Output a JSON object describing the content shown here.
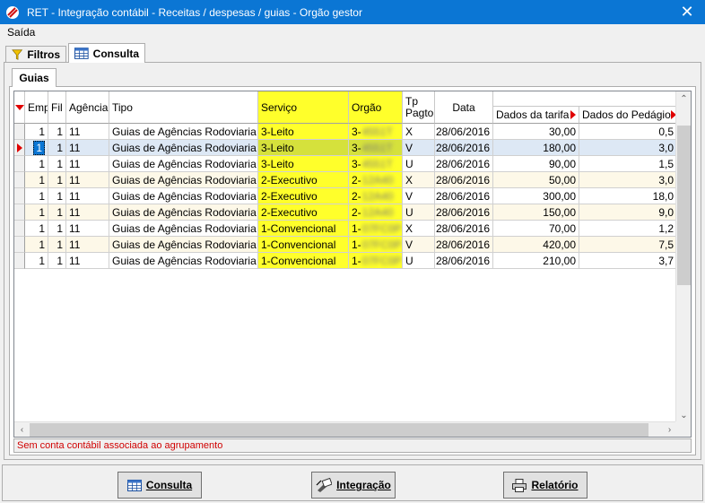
{
  "window": {
    "title": "RET -  Integração contábil - Receitas / despesas / guias - Orgão gestor",
    "close_glyph": "✕"
  },
  "menu": {
    "items": [
      "Saída"
    ]
  },
  "outer_tabs": [
    {
      "label": "Filtros",
      "icon": "funnel-icon"
    },
    {
      "label": "Consulta",
      "icon": "table-icon"
    }
  ],
  "inner_tab": {
    "label": "Guias"
  },
  "grid": {
    "columns": {
      "emp": "Emp",
      "fil": "Fil",
      "agencia": "Agência",
      "tipo": "Tipo",
      "servico": "Serviço",
      "orgao": "Orgão",
      "tp_pagto_line1": "Tp",
      "tp_pagto_line2": "Pagto",
      "data": "Data",
      "dados_tarifa": "Dados da tarifa",
      "dados_pedagio": "Dados do Pedágio"
    },
    "rows": [
      {
        "emp": "1",
        "fil": "1",
        "agencia": "11",
        "tipo": "Guias de Agências Rodoviaria I...",
        "servico": "3-Leito",
        "orgao_prefix": "3-",
        "orgao_hidden": "4551T",
        "tp": "X",
        "data": "28/06/2016",
        "tarifa": "30,00",
        "pedagio": "0,5"
      },
      {
        "emp": "1",
        "fil": "1",
        "agencia": "11",
        "tipo": "Guias de Agências Rodoviaria I...",
        "servico": "3-Leito",
        "orgao_prefix": "3-",
        "orgao_hidden": "4551T",
        "tp": "V",
        "data": "28/06/2016",
        "tarifa": "180,00",
        "pedagio": "3,0"
      },
      {
        "emp": "1",
        "fil": "1",
        "agencia": "11",
        "tipo": "Guias de Agências Rodoviaria I...",
        "servico": "3-Leito",
        "orgao_prefix": "3-",
        "orgao_hidden": "4551T",
        "tp": "U",
        "data": "28/06/2016",
        "tarifa": "90,00",
        "pedagio": "1,5"
      },
      {
        "emp": "1",
        "fil": "1",
        "agencia": "11",
        "tipo": "Guias de Agências Rodoviaria I...",
        "servico": "2-Executivo",
        "orgao_prefix": "2-",
        "orgao_hidden": "12A40",
        "tp": "X",
        "data": "28/06/2016",
        "tarifa": "50,00",
        "pedagio": "3,0"
      },
      {
        "emp": "1",
        "fil": "1",
        "agencia": "11",
        "tipo": "Guias de Agências Rodoviaria I...",
        "servico": "2-Executivo",
        "orgao_prefix": "2-",
        "orgao_hidden": "12A40",
        "tp": "V",
        "data": "28/06/2016",
        "tarifa": "300,00",
        "pedagio": "18,0"
      },
      {
        "emp": "1",
        "fil": "1",
        "agencia": "11",
        "tipo": "Guias de Agências Rodoviaria I...",
        "servico": "2-Executivo",
        "orgao_prefix": "2-",
        "orgao_hidden": "12A40",
        "tp": "U",
        "data": "28/06/2016",
        "tarifa": "150,00",
        "pedagio": "9,0"
      },
      {
        "emp": "1",
        "fil": "1",
        "agencia": "11",
        "tipo": "Guias de Agências Rodoviaria I...",
        "servico": "1-Convencional",
        "orgao_prefix": "1-",
        "orgao_hidden": "07FC0P",
        "tp": "X",
        "data": "28/06/2016",
        "tarifa": "70,00",
        "pedagio": "1,2"
      },
      {
        "emp": "1",
        "fil": "1",
        "agencia": "11",
        "tipo": "Guias de Agências Rodoviaria I...",
        "servico": "1-Convencional",
        "orgao_prefix": "1-",
        "orgao_hidden": "07FC0P",
        "tp": "V",
        "data": "28/06/2016",
        "tarifa": "420,00",
        "pedagio": "7,5"
      },
      {
        "emp": "1",
        "fil": "1",
        "agencia": "11",
        "tipo": "Guias de Agências Rodoviaria I...",
        "servico": "1-Convencional",
        "orgao_prefix": "1-",
        "orgao_hidden": "07FC0P",
        "tp": "U",
        "data": "28/06/2016",
        "tarifa": "210,00",
        "pedagio": "3,7"
      }
    ],
    "selected_row": 1
  },
  "status": {
    "message": "Sem conta contábil associada ao agrupamento"
  },
  "buttons": {
    "consulta": "Consulta",
    "integracao": "Integração",
    "relatorio": "Relatório"
  },
  "colors": {
    "title_bar": "#0b76d4",
    "highlight": "#ffff2b",
    "status_text": "#d00000",
    "indicator": "#e00000"
  }
}
